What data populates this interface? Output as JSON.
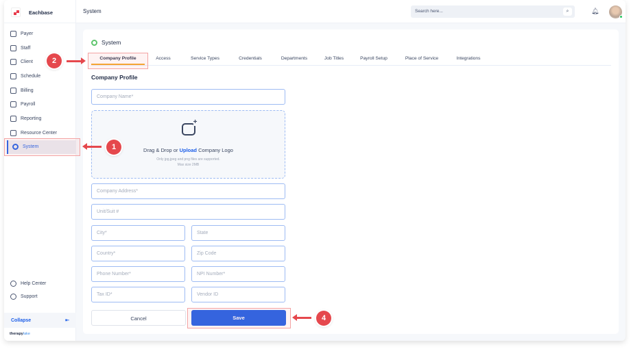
{
  "app": {
    "name": "Eachbase",
    "brand_a": "therapy",
    "brand_b": "lake"
  },
  "header": {
    "title": "System",
    "search_placeholder": "Search here..."
  },
  "sidebar": {
    "items": [
      {
        "label": "Payer",
        "icon": "shield-icon"
      },
      {
        "label": "Staff",
        "icon": "users-icon"
      },
      {
        "label": "Client",
        "icon": "client-icon"
      },
      {
        "label": "Schedule",
        "icon": "calendar-icon"
      },
      {
        "label": "Billing",
        "icon": "billing-icon"
      },
      {
        "label": "Payroll",
        "icon": "payroll-icon"
      },
      {
        "label": "Reporting",
        "icon": "report-icon"
      },
      {
        "label": "Resource Center",
        "icon": "folder-icon"
      },
      {
        "label": "System",
        "icon": "system-icon",
        "active": true
      }
    ],
    "bottom": [
      {
        "label": "Help Center"
      },
      {
        "label": "Support"
      }
    ],
    "collapse": "Collapse",
    "collapse_icon": "⇤"
  },
  "main": {
    "title": "System",
    "tabs": [
      "Company Profile",
      "Access",
      "Service Types",
      "Credentials",
      "Departments",
      "Job Titles",
      "Payroll Setup",
      "Place of Service",
      "Integrations"
    ],
    "section": "Company Profile",
    "fields": {
      "company_name": "Company Name*",
      "address": "Company Address*",
      "unit": "Unit/Suit #",
      "city": "City*",
      "state": "State",
      "country": "Country*",
      "zip": "Zip Code",
      "phone": "Phone Number*",
      "npi": "NPI Number*",
      "tax": "Tax ID*",
      "vendor": "Vendor ID"
    },
    "upload": {
      "pre": "Drag & Drop or ",
      "link": "Upload",
      "post": " Company Logo",
      "hint1": "Only jpg,jpeg and png files are  supported.",
      "hint2": "Max size 2MB"
    },
    "cancel": "Cancel",
    "save": "Save"
  },
  "annotations": [
    "1",
    "2",
    "4"
  ]
}
